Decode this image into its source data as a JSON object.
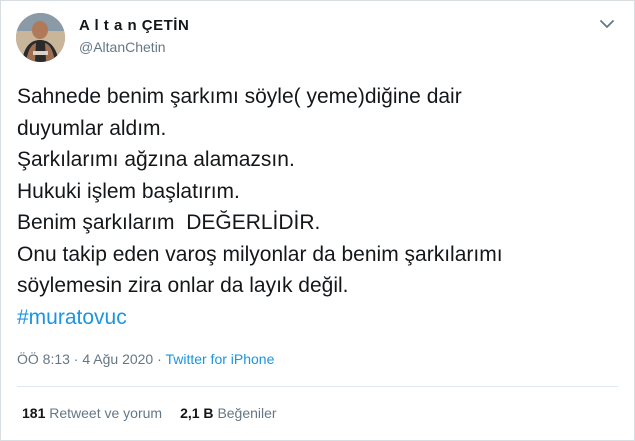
{
  "author": {
    "name": "A l t a n ÇETİN",
    "handle": "@AltanChetin"
  },
  "tweet": {
    "lines": [
      "Sahnede benim şarkımı söyle( yeme)diğine dair",
      "duyumlar aldım.",
      "Şarkılarımı ağzına alamazsın.",
      "Hukuki işlem başlatırım.",
      "Benim şarkılarım  DEĞERLİDİR.",
      "Onu takip eden varoş milyonlar da benim şarkılarımı",
      "söylemesin zira onlar da layık değil."
    ],
    "hashtag": "#muratovuc"
  },
  "meta": {
    "time": "ÖÖ 8:13",
    "separator1": " · ",
    "date": "4 Ağu 2020",
    "separator2": " · ",
    "source": "Twitter for iPhone"
  },
  "stats": {
    "retweets_count": "181",
    "retweets_label": "Retweet ve yorum",
    "likes_count": "2,1 B",
    "likes_label": "Beğeniler"
  },
  "colors": {
    "link": "#1b95e0",
    "text": "#14171a",
    "muted": "#657786"
  },
  "icons": {
    "menu": "chevron-down-icon"
  }
}
